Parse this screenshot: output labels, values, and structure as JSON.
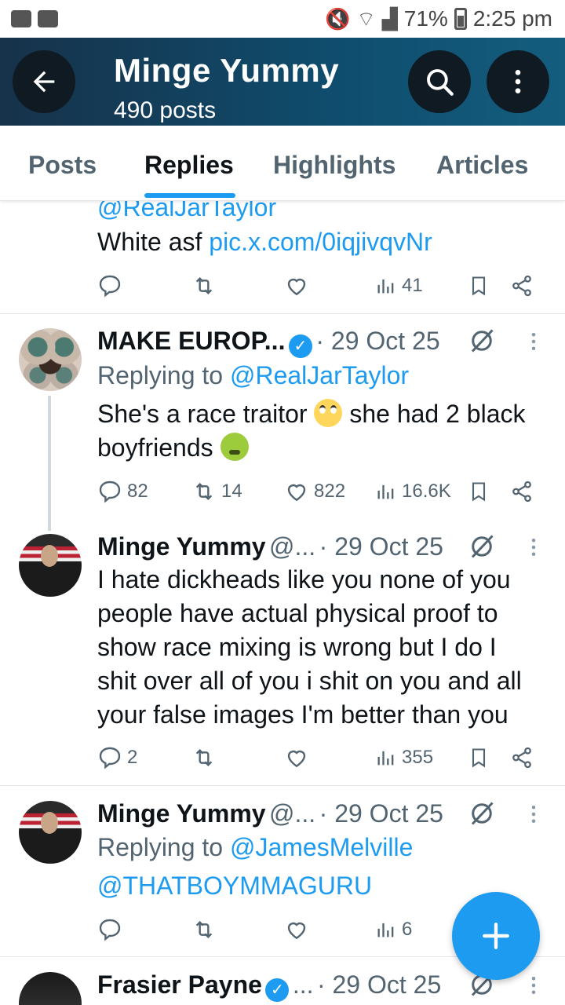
{
  "status_bar": {
    "battery": "71%",
    "time": "2:25 pm"
  },
  "header": {
    "title": "Minge Yummy",
    "subtitle": "490 posts"
  },
  "tabs": [
    {
      "label": "Posts"
    },
    {
      "label": "Replies"
    },
    {
      "label": "Highlights"
    },
    {
      "label": "Articles"
    }
  ],
  "active_tab": "Replies",
  "posts": [
    {
      "reply_to_partial": "@RealJarTaylor",
      "text_prefix": "White asf ",
      "link": "pic.x.com/0iqjivqvNr",
      "stats": {
        "replies": "",
        "reposts": "",
        "likes": "",
        "views": "41"
      }
    },
    {
      "name": "MAKE EUROP...",
      "verified": true,
      "date": "· 29 Oct 25",
      "reply_label": "Replying to ",
      "reply_handle": "@RealJarTaylor",
      "text_line1": "She's a race traitor",
      "text_line1b": "she had 2 black",
      "text_line2": "boyfriends",
      "stats": {
        "replies": "82",
        "reposts": "14",
        "likes": "822",
        "views": "16.6K"
      }
    },
    {
      "name": "Minge Yummy",
      "handle": "@...",
      "date": "· 29 Oct 25",
      "lines": [
        "I hate dickheads like you none of you",
        "people have actual physical proof to",
        "show race mixing is wrong but I do I",
        "shit over all of you i shit on you and all",
        "your false images I'm better than you"
      ],
      "stats": {
        "replies": "2",
        "reposts": "",
        "likes": "",
        "views": "355"
      }
    },
    {
      "name": "Minge Yummy",
      "handle": "@...",
      "date": "· 29 Oct 25",
      "reply_label": "Replying to ",
      "reply_handle": "@JamesMelville",
      "reply_handle2": "@THATBOYMMAGURU",
      "stats": {
        "replies": "",
        "reposts": "",
        "likes": "",
        "views": "6"
      }
    },
    {
      "name": "Frasier Payne",
      "verified": true,
      "handle": "...",
      "date": "· 29 Oct 25"
    }
  ],
  "icons": {
    "back": "arrow-left-icon",
    "search": "search-icon",
    "more": "more-vertical-icon",
    "reply": "reply-icon",
    "repost": "repost-icon",
    "like": "heart-icon",
    "views": "views-icon",
    "bookmark": "bookmark-icon",
    "share": "share-icon",
    "grok": "grok-icon",
    "compose": "plus-icon"
  },
  "colors": {
    "accent": "#1d9bf0",
    "header_bg": "#0f4d6e",
    "muted": "#536471"
  }
}
